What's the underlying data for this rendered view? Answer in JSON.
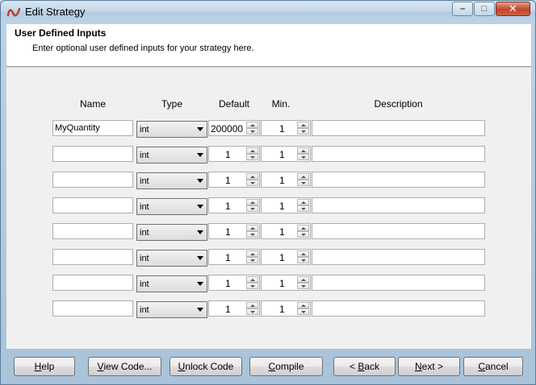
{
  "window": {
    "title": "Edit Strategy"
  },
  "header": {
    "title": "User Defined Inputs",
    "subtitle": "Enter optional user defined inputs for your strategy here."
  },
  "columns": {
    "name": "Name",
    "type": "Type",
    "default": "Default",
    "min": "Min.",
    "description": "Description"
  },
  "rows": [
    {
      "name": "MyQuantity",
      "type": "int",
      "default": "200000",
      "min": "1",
      "description": ""
    },
    {
      "name": "",
      "type": "int",
      "default": "1",
      "min": "1",
      "description": ""
    },
    {
      "name": "",
      "type": "int",
      "default": "1",
      "min": "1",
      "description": ""
    },
    {
      "name": "",
      "type": "int",
      "default": "1",
      "min": "1",
      "description": ""
    },
    {
      "name": "",
      "type": "int",
      "default": "1",
      "min": "1",
      "description": ""
    },
    {
      "name": "",
      "type": "int",
      "default": "1",
      "min": "1",
      "description": ""
    },
    {
      "name": "",
      "type": "int",
      "default": "1",
      "min": "1",
      "description": ""
    },
    {
      "name": "",
      "type": "int",
      "default": "1",
      "min": "1",
      "description": ""
    }
  ],
  "buttons": {
    "help": {
      "key": "H",
      "rest": "elp"
    },
    "view_code": {
      "key": "V",
      "rest": "iew Code..."
    },
    "unlock_code": {
      "key": "U",
      "rest": "nlock Code"
    },
    "compile": {
      "key": "C",
      "rest": "ompile"
    },
    "back": {
      "prefix": "< ",
      "key": "B",
      "rest": "ack"
    },
    "next": {
      "key": "N",
      "rest": "ext >"
    },
    "cancel": {
      "key": "C",
      "rest": "ancel"
    }
  },
  "icons": {
    "app": "ninjatrader-logo-icon",
    "minimize": "minimize-icon",
    "maximize": "maximize-icon",
    "close": "close-icon"
  }
}
